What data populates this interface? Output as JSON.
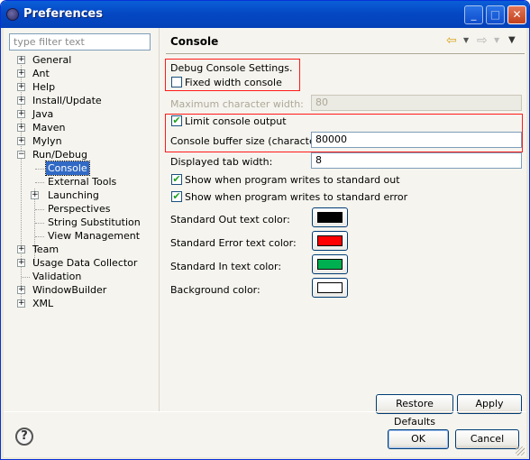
{
  "window": {
    "title": "Preferences",
    "minimize_glyph": "_",
    "maximize_glyph": "□",
    "close_glyph": "✕"
  },
  "sidebar": {
    "filter_placeholder": "type filter text",
    "tree": [
      {
        "label": "General",
        "expander": "+"
      },
      {
        "label": "Ant",
        "expander": "+"
      },
      {
        "label": "Help",
        "expander": "+"
      },
      {
        "label": "Install/Update",
        "expander": "+"
      },
      {
        "label": "Java",
        "expander": "+"
      },
      {
        "label": "Maven",
        "expander": "+"
      },
      {
        "label": "Mylyn",
        "expander": "+"
      },
      {
        "label": "Run/Debug",
        "expander": "−"
      },
      {
        "label": "Console",
        "selected": true
      },
      {
        "label": "External Tools"
      },
      {
        "label": "Launching",
        "expander": "+"
      },
      {
        "label": "Perspectives"
      },
      {
        "label": "String Substitution"
      },
      {
        "label": "View Management"
      },
      {
        "label": "Team",
        "expander": "+"
      },
      {
        "label": "Usage Data Collector",
        "expander": "+"
      },
      {
        "label": "Validation"
      },
      {
        "label": "WindowBuilder",
        "expander": "+"
      },
      {
        "label": "XML",
        "expander": "+"
      }
    ]
  },
  "page": {
    "title": "Console",
    "nav_back_icon": "back-arrow-icon",
    "nav_forward_icon": "forward-arrow-icon",
    "menu_icon": "view-menu-icon",
    "debug_settings_label": "Debug Console Settings.",
    "fixed_width": {
      "label": "Fixed width console",
      "checked": false
    },
    "max_char_width": {
      "label": "Maximum character width:",
      "value": "80",
      "enabled": false
    },
    "limit_output": {
      "label": "Limit console output",
      "checked": true
    },
    "buffer_size": {
      "label": "Console buffer size (characters):",
      "value": "80000"
    },
    "tab_width": {
      "label": "Displayed tab width:",
      "value": "8"
    },
    "show_stdout": {
      "label": "Show when program writes to standard out",
      "checked": true
    },
    "show_stderr": {
      "label": "Show when program writes to standard error",
      "checked": true
    },
    "colors": [
      {
        "label": "Standard Out text color:",
        "color": "#000000"
      },
      {
        "label": "Standard Error text color:",
        "color": "#ff0000"
      },
      {
        "label": "Standard In text color:",
        "color": "#00b050"
      },
      {
        "label": "Background color:",
        "color": "#ffffff"
      }
    ],
    "restore_defaults_label": "Restore Defaults",
    "apply_label": "Apply"
  },
  "footer": {
    "help_glyph": "?",
    "ok_label": "OK",
    "cancel_label": "Cancel"
  },
  "highlight_color": "#ff1a1a",
  "selection_color": "#316ac5"
}
